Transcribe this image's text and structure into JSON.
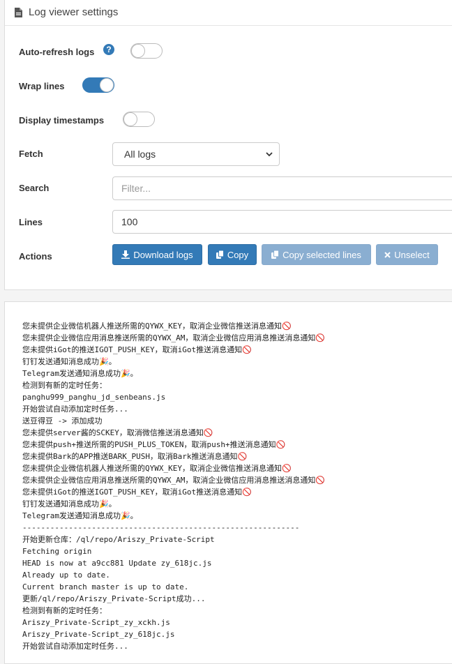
{
  "panel": {
    "title": "Log viewer settings"
  },
  "settings": {
    "auto_refresh": {
      "label": "Auto-refresh logs",
      "help": "?",
      "enabled": false
    },
    "wrap_lines": {
      "label": "Wrap lines",
      "enabled": true
    },
    "display_timestamps": {
      "label": "Display timestamps",
      "enabled": false
    },
    "fetch": {
      "label": "Fetch",
      "selected": "All logs"
    },
    "search": {
      "label": "Search",
      "placeholder": "Filter...",
      "value": ""
    },
    "lines": {
      "label": "Lines",
      "value": "100"
    },
    "actions": {
      "label": "Actions",
      "download": "Download logs",
      "copy": "Copy",
      "copy_selected": "Copy selected lines",
      "unselect": "Unselect"
    }
  },
  "colors": {
    "primary": "#337ab7",
    "disabled": "#8aaed1"
  },
  "log": {
    "lines": [
      "您未提供企业微信机器人推送所需的QYWX_KEY，取消企业微信推送消息通知🚫",
      "您未提供企业微信应用消息推送所需的QYWX_AM，取消企业微信应用消息推送消息通知🚫",
      "您未提供iGot的推送IGOT_PUSH_KEY，取消iGot推送消息通知🚫",
      "钉钉发送通知消息成功🎉。",
      "Telegram发送通知消息成功🎉。",
      "检测到有新的定时任务：",
      "panghu999_panghu_jd_senbeans.js",
      "开始尝试自动添加定时任务...",
      "送豆得豆 -> 添加成功",
      "您未提供server酱的SCKEY，取消微信推送消息通知🚫",
      "您未提供push+推送所需的PUSH_PLUS_TOKEN，取消push+推送消息通知🚫",
      "您未提供Bark的APP推送BARK_PUSH，取消Bark推送消息通知🚫",
      "您未提供企业微信机器人推送所需的QYWX_KEY，取消企业微信推送消息通知🚫",
      "您未提供企业微信应用消息推送所需的QYWX_AM，取消企业微信应用消息推送消息通知🚫",
      "您未提供iGot的推送IGOT_PUSH_KEY，取消iGot推送消息通知🚫",
      "钉钉发送通知消息成功🎉。",
      "Telegram发送通知消息成功🎉。",
      "------------------------------------------------------------",
      "开始更新仓库：/ql/repo/Ariszy_Private-Script",
      "Fetching origin",
      "HEAD is now at a9cc881 Update zy_618jc.js",
      "Already up to date.",
      "Current branch master is up to date.",
      "更新/ql/repo/Ariszy_Private-Script成功...",
      "检测到有新的定时任务：",
      "Ariszy_Private-Script_zy_xckh.js",
      "Ariszy_Private-Script_zy_618jc.js",
      "开始尝试自动添加定时任务..."
    ]
  }
}
